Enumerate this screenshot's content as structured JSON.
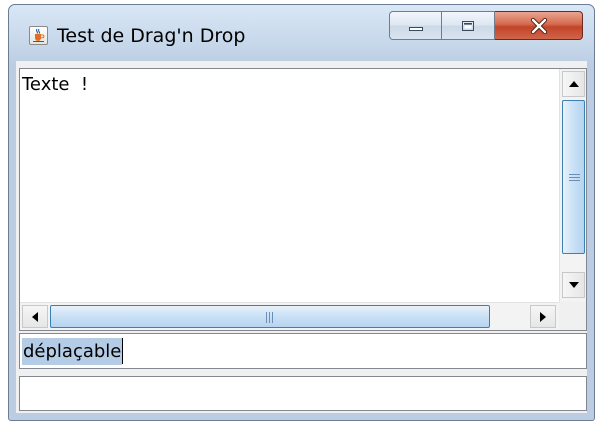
{
  "window": {
    "title": "Test de Drag'n Drop",
    "icon": "java-coffee-cup-icon",
    "controls": {
      "minimize_icon": "minimize-icon",
      "maximize_icon": "maximize-icon",
      "close_icon": "close-icon"
    },
    "colors": {
      "titlebar": "#c6d7ea",
      "close_button": "#c9462a",
      "selection_highlight": "#b5cce6",
      "scroll_thumb": "#c9e0f5"
    }
  },
  "text_area": {
    "content": "Texte  !"
  },
  "drag_field": {
    "value": "déplaçable",
    "selected": true
  },
  "drop_field": {
    "value": ""
  }
}
